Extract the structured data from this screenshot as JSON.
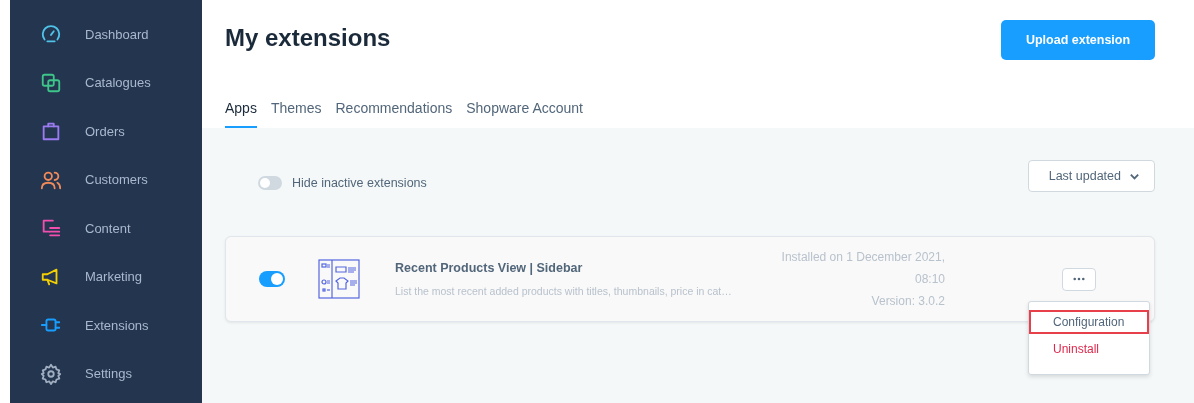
{
  "sidebar": {
    "items": [
      {
        "label": "Dashboard",
        "kind": "gauge",
        "color": "#4fc3e8"
      },
      {
        "label": "Catalogues",
        "kind": "copies",
        "color": "#3ec58a"
      },
      {
        "label": "Orders",
        "kind": "bag",
        "color": "#9a7cf0"
      },
      {
        "label": "Customers",
        "kind": "people",
        "color": "#f08a5a"
      },
      {
        "label": "Content",
        "kind": "content",
        "color": "#f04fae"
      },
      {
        "label": "Marketing",
        "kind": "megaphone",
        "color": "#f5d000"
      },
      {
        "label": "Extensions",
        "kind": "plug",
        "color": "#189eff"
      },
      {
        "label": "Settings",
        "kind": "gear",
        "color": "#a0aec0"
      }
    ]
  },
  "page": {
    "title": "My extensions",
    "upload_button": "Upload extension"
  },
  "tabs": [
    {
      "label": "Apps",
      "selected": true
    },
    {
      "label": "Themes",
      "selected": false
    },
    {
      "label": "Recommendations",
      "selected": false
    },
    {
      "label": "Shopware Account",
      "selected": false
    }
  ],
  "filter": {
    "toggle_label": "Hide inactive extensions",
    "on": false,
    "sort": "Last updated"
  },
  "extensions": [
    {
      "name": "Recent Products View | Sidebar",
      "description": "List the most recent added products with titles, thumbnails, price in cat…",
      "active": true,
      "installed": "Installed on 1 December 2021,",
      "installed_time": "08:10",
      "version": "Version: 3.0.2",
      "menu": {
        "open": true,
        "items": [
          {
            "label": "Configuration",
            "kind": "normal",
            "highlighted": true
          },
          {
            "label": "Uninstall",
            "kind": "danger",
            "highlighted": false
          }
        ]
      }
    }
  ]
}
